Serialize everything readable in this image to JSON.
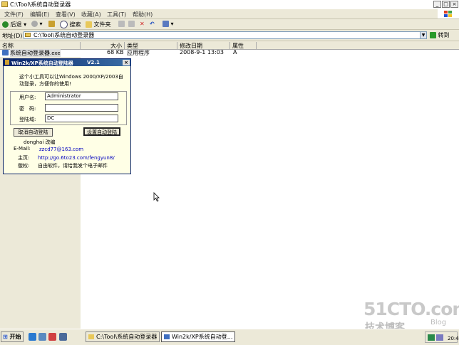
{
  "window": {
    "title": "C:\\Tool\\系统自动登录器"
  },
  "menu": [
    "文件(F)",
    "编辑(E)",
    "查看(V)",
    "收藏(A)",
    "工具(T)",
    "帮助(H)"
  ],
  "toolbar": {
    "back": "后退",
    "search": "搜索",
    "folders": "文件夹"
  },
  "address": {
    "label": "地址(D)",
    "value": "C:\\Tool\\系统自动登录器",
    "go": "转到"
  },
  "columns": {
    "name": "名称",
    "size": "大小",
    "type": "类型",
    "modified": "修改日期",
    "attr": "属性"
  },
  "file": {
    "name": "系统自动登录器",
    "ext": ".exe",
    "size": "68 KB",
    "type": "应用程序",
    "modified": "2008-9-1 13:03",
    "attr": "A"
  },
  "dialog": {
    "title": "Win2k/XP系统自动登陆器",
    "version": "V2.1",
    "close": "×",
    "desc1": "这个小工具可以让Windows 2000/XP/2003自",
    "desc2": "动登录，方便你的使用!",
    "user_label": "用户名:",
    "user_value": "Administrator",
    "pass_label": "密　码:",
    "pass_value": "",
    "domain_label": "登陆域:",
    "domain_value": "DC",
    "cancel_btn": "取消自动登陆",
    "set_btn": "设置自动登陆",
    "author_name": "donghai 改编",
    "email_label": "E-Mail:",
    "email_value": "zzcd77@163.com",
    "home_label": "主页:",
    "home_value": "http://go.6to23.com/fengyun8/",
    "rights_label": "版权:",
    "rights_value": "自由软件，请给我发个电子邮件"
  },
  "watermark": {
    "main": "51CTO.com",
    "sub": "技术博客",
    "blog": "Blog"
  },
  "taskbar": {
    "start": "开始",
    "task1": "C:\\Tool\\系统自动登录器",
    "task2": "Win2k/XP系统自动登...",
    "clock": "20:49"
  }
}
